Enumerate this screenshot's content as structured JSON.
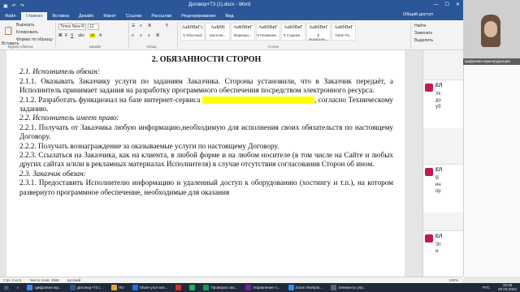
{
  "titlebar": {
    "title": "Договор+Т3 (1).docx - Word",
    "share": "Общий доступ"
  },
  "tabs": [
    "Файл",
    "Главная",
    "Вставка",
    "Дизайн",
    "Макет",
    "Ссылки",
    "Рассылки",
    "Рецензирование",
    "Вид"
  ],
  "ribbon": {
    "paste": "Вставить",
    "cut": "Вырезать",
    "copy": "Копировать",
    "format_painter": "Формат по образцу",
    "clipboard": "Буфер обмена",
    "font_name": "Times New R",
    "font_size": "12",
    "font_group": "Шрифт",
    "paragraph_group": "Абзац",
    "styles_group": "Стили",
    "styles": [
      {
        "sample": "АаБбВвГг,",
        "name": "¶ Обычный"
      },
      {
        "sample": "АаБбВ",
        "name": "Заголов..."
      },
      {
        "sample": "АаБбВвГ",
        "name": "Маркеры..."
      },
      {
        "sample": "АаБбВвГ",
        "name": "¶ Название..."
      },
      {
        "sample": "АаБбВвГ",
        "name": "¶ Содерж..."
      },
      {
        "sample": "АаБбВвГ",
        "name": "¶ Указатель..."
      },
      {
        "sample": "АаБбВвГ",
        "name": "Table Pa..."
      }
    ],
    "find": "Найти",
    "replace": "Заменить",
    "select": "Выделить"
  },
  "document": {
    "heading": "2. ОБЯЗАННОСТИ СТОРОН",
    "s21": "2.1. Исполнитель обязан:",
    "p211": "2.1.1. Оказывать Заказчику услуги по заданиям Заказчика. Стороны установили, что в Заказчик передаёт, а Исполнитель принимает задания на разработку программного обеспечения посредством электронного ресурса.",
    "p212a": "2.1.2. Разработать функционал на базе интернет-сервиса",
    "p212b": ", согласно Техническому заданию.",
    "s22": "2.2. Исполнитель имеет право:",
    "p221": "2.2.1. Получать от Заказчика любую информацию,необходимую для исполнения своих обязательств по настоящему Договору.",
    "p222": "2.2.2. Получать вознаграждение за оказываемые услуги по настоящему Договору.",
    "p223": "2.2.3. Ссылаться на Заказчика, как на клиента, в любой форме и на любом носителе (в том числе на Сайте и любых других сайтах и/или в рекламных материалах Исполнителя) в случае отсутствия согласования Сторон об ином.",
    "s23": "2.3. Заказчик обязан:",
    "p231": "2.3.1. Предоставить Исполнителю информацию и удаленный доступ к оборудованию (хостингу и т.п.), на котором развернуто программное обеспечение, необходимые для оказания"
  },
  "comments": [
    {
      "author": "ЕЛ",
      "text": "Ук\nдо\nуб"
    },
    {
      "author": "ЕЛ",
      "text": "В\nин\nпр"
    },
    {
      "author": "ЕЛ",
      "text": "Эт\nи"
    }
  ],
  "video": {
    "caption": "Цифровая юриспруденция"
  },
  "statusbar": {
    "page": "Стр. 2 из 5",
    "words": "Число слов: 1566",
    "lang": "русский",
    "zoom": "100%"
  },
  "taskbar": [
    {
      "label": "Цифровая юр...",
      "color": "#2d8cff"
    },
    {
      "label": "Договор+Т3 (...",
      "color": "#2b579a"
    },
    {
      "label": "ПО",
      "color": "#e8a33d"
    },
    {
      "label": "Share your wor...",
      "color": "#1a73e8"
    },
    {
      "label": "",
      "color": "#d93025"
    },
    {
      "label": "",
      "color": "#34a853"
    },
    {
      "label": "Проверка сво...",
      "color": "#0f9d58"
    },
    {
      "label": "Управление п...",
      "color": "#7b1fa2"
    },
    {
      "label": "Zoom Workpla...",
      "color": "#2d8cff"
    },
    {
      "label": "Элементы упр...",
      "color": "#5f6368"
    }
  ],
  "tray": {
    "time": "19:36",
    "date": "20.03.2024",
    "lang": "РУС"
  }
}
